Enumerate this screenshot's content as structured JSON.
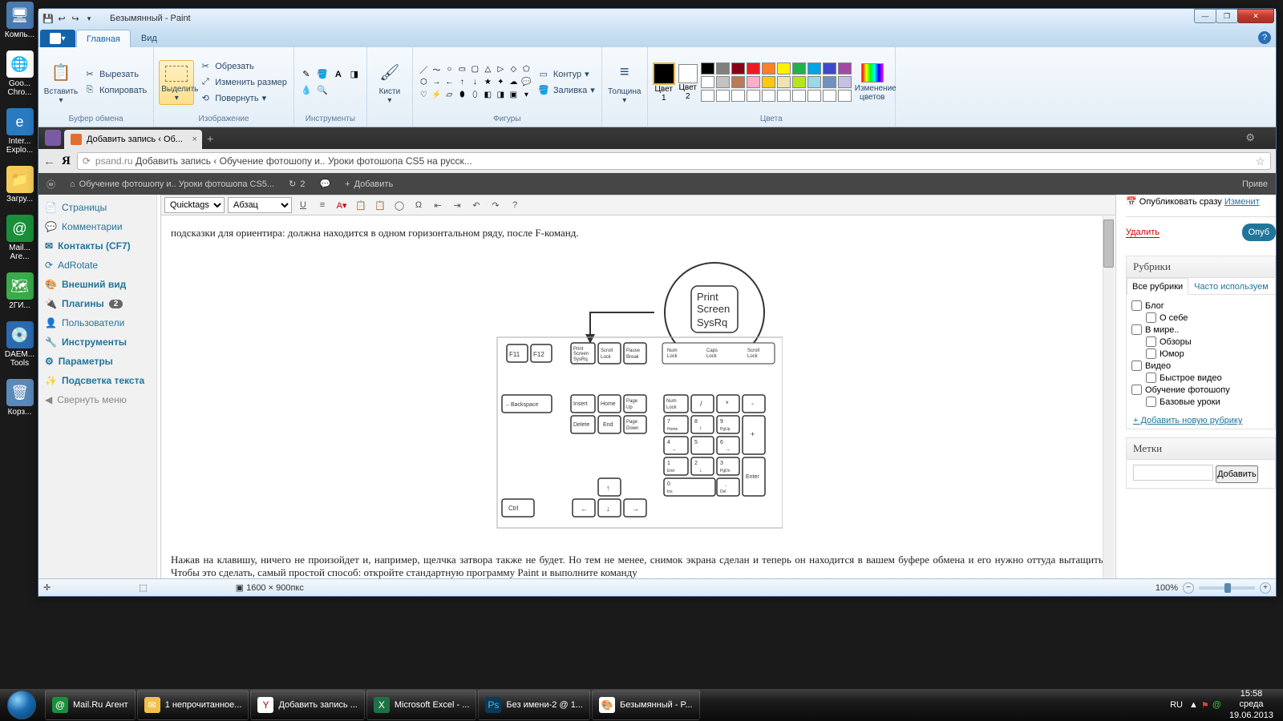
{
  "desktop": {
    "icons": [
      "Компь...",
      "Goo...\nChro...",
      "Inter...\nExplo...",
      "Загру...",
      "Mail...\nАге...",
      "2ГИ...",
      "DAEM...\nTools",
      "Корз..."
    ]
  },
  "paint": {
    "title": "Безымянный - Paint",
    "tabs": {
      "home": "Главная",
      "view": "Вид"
    },
    "ribbon": {
      "clipboard": {
        "label": "Буфер обмена",
        "paste": "Вставить",
        "cut": "Вырезать",
        "copy": "Копировать"
      },
      "image": {
        "label": "Изображение",
        "select": "Выделить",
        "crop": "Обрезать",
        "resize": "Изменить размер",
        "rotate": "Повернуть"
      },
      "tools": {
        "label": "Инструменты"
      },
      "brushes": {
        "label": "Кисти"
      },
      "shapes": {
        "label": "Фигуры",
        "outline": "Контур",
        "fill": "Заливка"
      },
      "thickness": {
        "label": "Толщина"
      },
      "colors": {
        "c1": "Цвет\n1",
        "c2": "Цвет\n2",
        "label": "Цвета",
        "edit": "Изменение\nцветов"
      }
    },
    "status": {
      "dims": "1600 × 900пкс",
      "zoom": "100%"
    }
  },
  "browser": {
    "tab": "Добавить запись ‹ Об...",
    "address": {
      "host": "psand.ru",
      "path": "Добавить запись ‹ Обучение фотошопу и.. Уроки фотошопа CS5 на русск..."
    }
  },
  "wpbar": {
    "site": "Обучение фотошопу и.. Уроки фотошопа CS5...",
    "refresh": "2",
    "add": "Добавить",
    "greeting": "Приве"
  },
  "sidebar": {
    "items": [
      "Страницы",
      "Комментарии",
      "Контакты (CF7)",
      "AdRotate",
      "Внешний вид",
      "Плагины",
      "Пользователи",
      "Инструменты",
      "Параметры",
      "Подсветка текста"
    ],
    "plugins_badge": "2",
    "collapse": "Свернуть меню"
  },
  "editor": {
    "quicktags": "Quicktags",
    "format": "Абзац",
    "p1": "подсказки для ориентира: должна находится в одном горизонтальном ряду, после F-команд.",
    "p2": "Нажав на клавишу, ничего не произойдет и, например, щелчка затвора также не будет. Но тем не менее, снимок экрана сделан и теперь он находится в вашем буфере обмена и его нужно оттуда вытащить. Чтобы это сделать, самый простой способ: откройте стандартную программу Paint и выполните команду"
  },
  "publish": {
    "label": "Опубликовать сразу",
    "edit": "Изменит",
    "delete": "Удалить",
    "submit": "Опуб"
  },
  "categories": {
    "title": "Рубрики",
    "tab_all": "Все рубрики",
    "tab_freq": "Часто используем",
    "items": [
      "Блог",
      "О себе",
      "В мире..",
      "Обзоры",
      "Юмор",
      "Видео",
      "Быстрое видео",
      "Обучение фотошопу",
      "Базовые уроки"
    ],
    "add": "+ Добавить новую рубрику"
  },
  "tags": {
    "title": "Метки",
    "add": "Добавить"
  },
  "taskbar": {
    "items": [
      "Mail.Ru Агент",
      "1 непрочитанное...",
      "Добавить запись ...",
      "Microsoft Excel - ...",
      "Без имени-2 @ 1...",
      "Безымянный - P..."
    ],
    "lang": "RU",
    "time": "15:58",
    "day": "среда",
    "date": "19.06.2013"
  },
  "palette": [
    "#000",
    "#7f7f7f",
    "#880015",
    "#ed1c24",
    "#ff7f27",
    "#fff200",
    "#22b14c",
    "#00a2e8",
    "#3f48cc",
    "#a349a4",
    "#fff",
    "#c3c3c3",
    "#b97a57",
    "#ffaec9",
    "#ffc90e",
    "#efe4b0",
    "#b5e61d",
    "#99d9ea",
    "#7092be",
    "#c8bfe7"
  ]
}
